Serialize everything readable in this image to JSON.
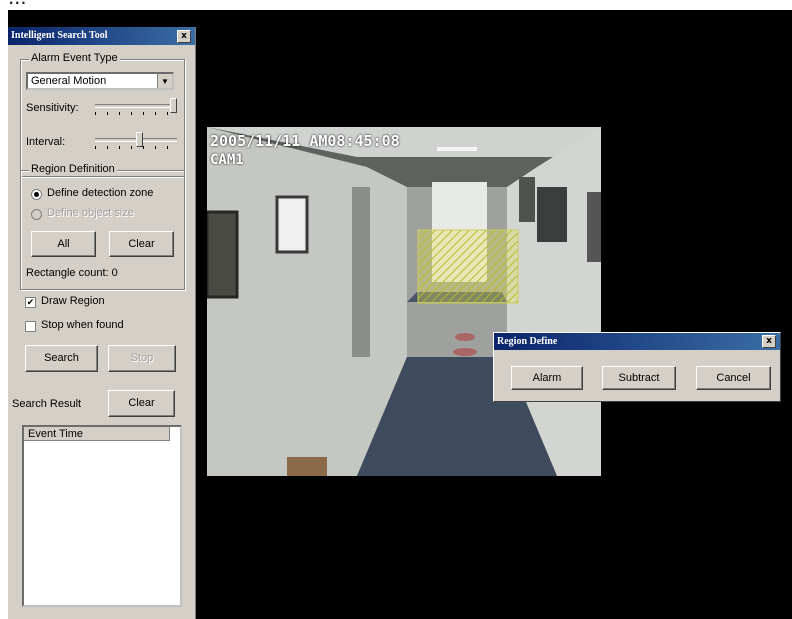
{
  "top_strip_text": "....",
  "tool": {
    "title": "Intelligent Search Tool",
    "close_glyph": "x",
    "alarm_event_type": {
      "legend": "Alarm Event Type",
      "selected": "General Motion"
    },
    "sensitivity_label": "Sensitivity:",
    "sensitivity_level": 1.0,
    "interval_label": "Interval:",
    "interval_level": 0.55,
    "region": {
      "legend": "Region Definition",
      "option_zone": "Define detection zone",
      "option_object": "Define object size",
      "all_label": "All",
      "clear_label": "Clear",
      "rect_count": "Rectangle count: 0"
    },
    "draw_region_label": "Draw Region",
    "draw_region_checked": true,
    "stop_when_found_label": "Stop when found",
    "stop_when_found_checked": false,
    "search_label": "Search",
    "stop_label": "Stop",
    "search_result_label": "Search Result",
    "result_clear_label": "Clear",
    "event_time_header": "Event Time"
  },
  "video": {
    "timestamp": "2005/11/11 AM08:45:08",
    "camera": "CAM1"
  },
  "popup": {
    "title": "Region Define",
    "close_glyph": "x",
    "alarm_label": "Alarm",
    "subtract_label": "Subtract",
    "cancel_label": "Cancel"
  }
}
